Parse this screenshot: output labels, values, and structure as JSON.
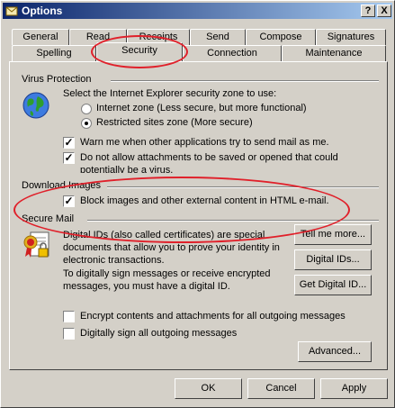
{
  "window": {
    "title": "Options"
  },
  "titlebar": {
    "help": "?",
    "close": "X"
  },
  "tabs_back": [
    "General",
    "Read",
    "Receipts",
    "Send",
    "Compose",
    "Signatures"
  ],
  "tabs_front": [
    "Spelling",
    "Security",
    "Connection",
    "Maintenance"
  ],
  "virus": {
    "heading": "Virus Protection",
    "zone_prompt": "Select the Internet Explorer security zone to use:",
    "zone_internet": "Internet zone (Less secure, but more functional)",
    "zone_restricted": "Restricted sites zone (More secure)",
    "warn_label": "Warn me when other applications try to send mail as me.",
    "attach_label_1": "Do not allow attachments to be saved or opened that could",
    "attach_label_2": "potentially be a virus."
  },
  "download": {
    "heading": "Download Images",
    "block_label": "Block images and other external content in HTML e-mail."
  },
  "secure": {
    "heading": "Secure Mail",
    "text_1": "Digital IDs (also called certificates) are special",
    "text_2": "documents that allow you to prove your identity in",
    "text_3": "electronic transactions.",
    "text_4": "To digitally sign messages or receive encrypted",
    "text_5": "messages, you must have a digital ID.",
    "tell_more": "Tell me more...",
    "digital_ids": "Digital IDs...",
    "get_id": "Get Digital ID...",
    "encrypt_label": "Encrypt contents and attachments for all outgoing messages",
    "sign_label": "Digitally sign all outgoing messages",
    "advanced": "Advanced..."
  },
  "footer": {
    "ok": "OK",
    "cancel": "Cancel",
    "apply": "Apply"
  },
  "state": {
    "zone": "restricted",
    "warn": true,
    "attach": true,
    "block": true,
    "encrypt": false,
    "sign": false
  },
  "colors": {
    "title_start": "#0a246a",
    "title_end": "#a6caf0",
    "annotation": "#e0202a"
  }
}
